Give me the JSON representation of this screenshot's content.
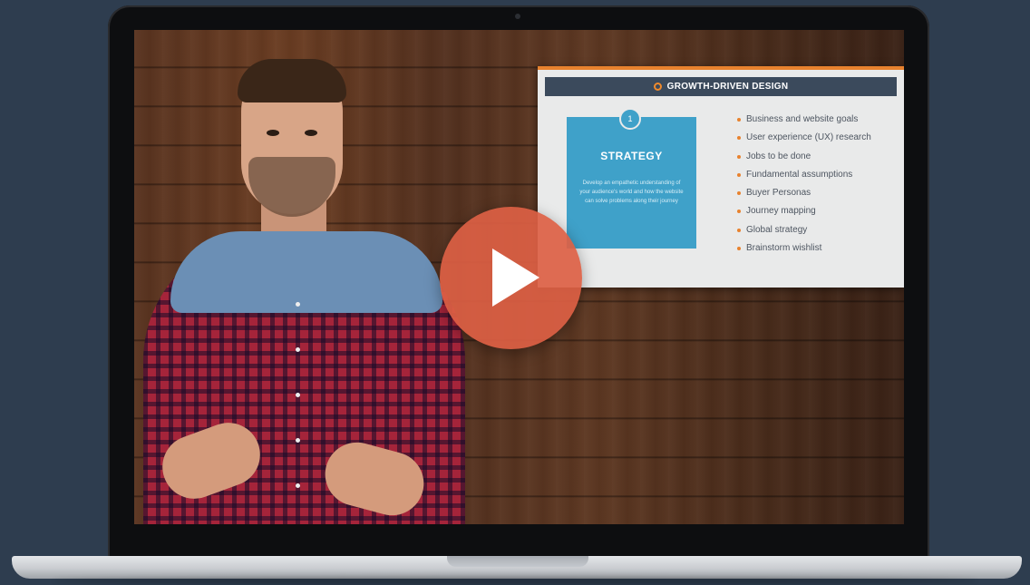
{
  "slide": {
    "header_title": "GROWTH-DRIVEN DESIGN",
    "card": {
      "step_number": "1",
      "title": "STRATEGY",
      "description": "Develop an empathetic understanding of your audience's world and how the website can solve problems along their journey"
    },
    "bullets": [
      "Business and website goals",
      "User experience (UX) research",
      "Jobs to be done",
      "Fundamental assumptions",
      "Buyer Personas",
      "Journey mapping",
      "Global strategy",
      "Brainstorm wishlist"
    ]
  },
  "player": {
    "play_icon": "play-icon"
  },
  "colors": {
    "page_background": "#2e3d4f",
    "play_button": "#dc5f44",
    "slide_accent": "#e8822e",
    "strategy_card": "#3fa1c9",
    "slide_header": "#3b4a5c"
  }
}
